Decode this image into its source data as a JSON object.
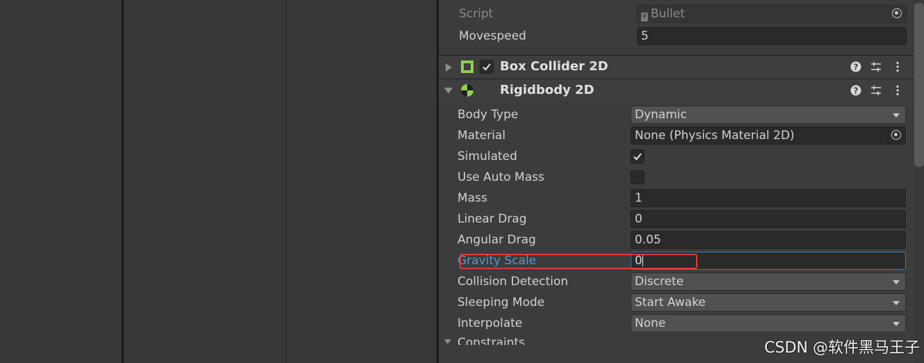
{
  "script_component": {
    "script_label": "Script",
    "script_value": "Bullet",
    "movespeed_label": "Movespeed",
    "movespeed_value": "5"
  },
  "box_collider": {
    "title": "Box Collider 2D",
    "icon": "box-collider-icon",
    "enabled": true
  },
  "rigidbody": {
    "title": "Rigidbody 2D",
    "icon": "rigidbody-icon",
    "properties": {
      "body_type": {
        "label": "Body Type",
        "value": "Dynamic"
      },
      "material": {
        "label": "Material",
        "value": "None (Physics Material 2D)"
      },
      "simulated": {
        "label": "Simulated",
        "checked": true
      },
      "use_auto_mass": {
        "label": "Use Auto Mass",
        "checked": false
      },
      "mass": {
        "label": "Mass",
        "value": "1"
      },
      "linear_drag": {
        "label": "Linear Drag",
        "value": "0"
      },
      "angular_drag": {
        "label": "Angular Drag",
        "value": "0.05"
      },
      "gravity_scale": {
        "label": "Gravity Scale",
        "value": "0"
      },
      "collision_detection": {
        "label": "Collision Detection",
        "value": "Discrete"
      },
      "sleeping_mode": {
        "label": "Sleeping Mode",
        "value": "Start Awake"
      },
      "interpolate": {
        "label": "Interpolate",
        "value": "None"
      },
      "constraints": {
        "label": "Constraints"
      }
    }
  },
  "watermark": "CSDN @软件黑马王子",
  "colors": {
    "accent_green": "#8fd14f",
    "focus_blue": "#3a79bb",
    "highlight_red": "#e03a3a"
  }
}
